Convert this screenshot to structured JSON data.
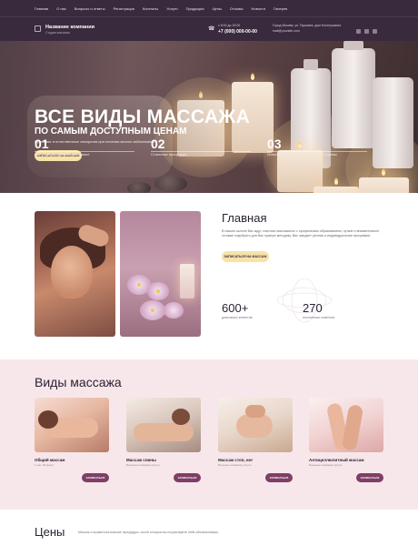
{
  "topnav": {
    "items": [
      "Главная",
      "О нас",
      "Вопросы и ответы",
      "Регистрация",
      "Контакты",
      "Услуги",
      "Продукция",
      "Цены",
      "Отзывы",
      "Новости",
      "Галерея"
    ]
  },
  "header": {
    "company_name": "Название компании",
    "company_sub": "Студия массажа",
    "phone_small": "с 8:00 до 20:00",
    "phone_main": "+7 (000) 000-00-00",
    "address": "Город Москва, ул. Пушкина, дом Колотушкина",
    "email": "mail@yoursite.com"
  },
  "hero": {
    "title": "ВСЕ ВИДЫ МАССАЖА",
    "subtitle": "ПО САМЫМ ДОСТУПНЫМ ЦЕНАМ",
    "tagline": "Приятные и естественные лекарства при лечении многих заболеваний",
    "button": "ЗАПИСАТЬСЯ НА МАССАЖ",
    "stats": [
      {
        "num": "01",
        "text": "Сертифицированный массажист"
      },
      {
        "num": "02",
        "text": "Стильные процедуры"
      },
      {
        "num": "03",
        "text": "Используем натуральные масла и кремы"
      }
    ]
  },
  "about": {
    "title": "Главная",
    "text": "В нашем салоне Вас ждут опытные массажисты с профильным образованием, чуткие и внимательные, готовые подобрать для Вас нужную методику. Вас ожидает уютная и индивидуальная программа.",
    "button": "ЗАПИСАТЬСЯ НА МАССАЖ",
    "stat1_num": "600+",
    "stat1_text": "довольных клиентов",
    "stat2_num": "270",
    "stat2_text": "постоянных клиентов"
  },
  "services": {
    "title": "Виды массажа",
    "cards": [
      {
        "name": "Общий массаж",
        "sub": "1 час, 30 минут",
        "button": "ЗАПИСАТЬСЯ"
      },
      {
        "name": "Массаж спины",
        "sub": "Большое описание услуги",
        "button": "ЗАПИСАТЬСЯ"
      },
      {
        "name": "Массаж стоп, ног",
        "sub": "Большое описание услуги",
        "button": "ЗАПИСАТЬСЯ"
      },
      {
        "name": "Антицеллюлитный массаж",
        "sub": "Большое описание услуги",
        "button": "ЗАПИСАТЬСЯ"
      }
    ]
  },
  "prices": {
    "title": "Цены",
    "text": "Массаж и косметологические процедуры, после которых вы почувствуете себя обновленными."
  }
}
